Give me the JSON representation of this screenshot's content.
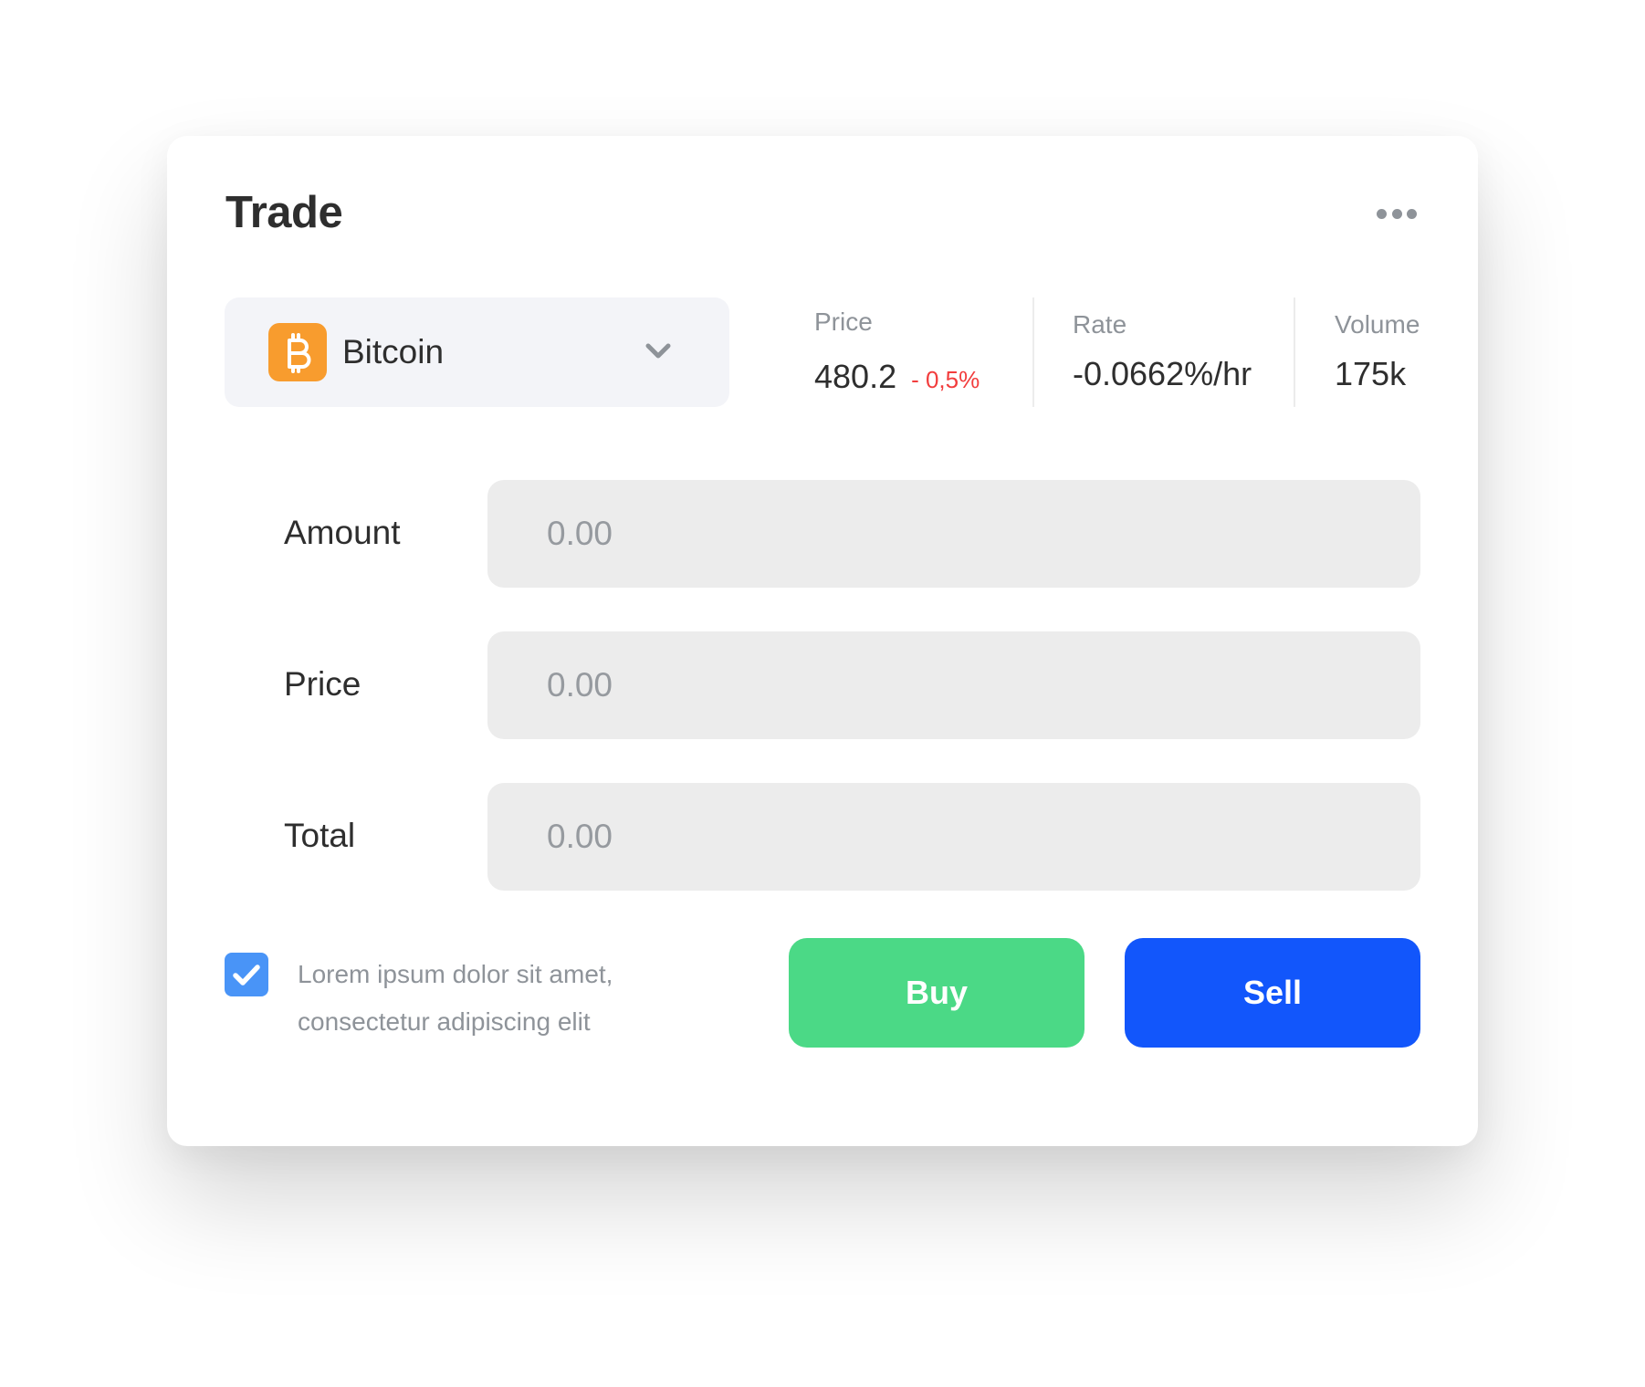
{
  "header": {
    "title": "Trade",
    "more_icon": "more-horizontal-icon"
  },
  "asset_selector": {
    "icon": "bitcoin-icon",
    "selected": "Bitcoin",
    "chevron_icon": "chevron-down-icon",
    "icon_color": "#f89c2e"
  },
  "stats": {
    "price": {
      "label": "Price",
      "value": "480.2",
      "change": "- 0,5%",
      "change_color": "#f23d3d"
    },
    "rate": {
      "label": "Rate",
      "value": "-0.0662%/hr"
    },
    "volume": {
      "label": "Volume",
      "value": "175k"
    }
  },
  "form": {
    "fields": [
      {
        "label": "Amount",
        "value": "",
        "placeholder": "0.00"
      },
      {
        "label": "Price",
        "value": "",
        "placeholder": "0.00"
      },
      {
        "label": "Total",
        "value": "",
        "placeholder": "0.00"
      }
    ]
  },
  "agreement": {
    "checked": true,
    "line1": "Lorem ipsum dolor sit amet,",
    "line2": "consectetur adipiscing elit"
  },
  "actions": {
    "buy_label": "Buy",
    "sell_label": "Sell",
    "buy_color": "#4bd986",
    "sell_color": "#1256fb"
  }
}
